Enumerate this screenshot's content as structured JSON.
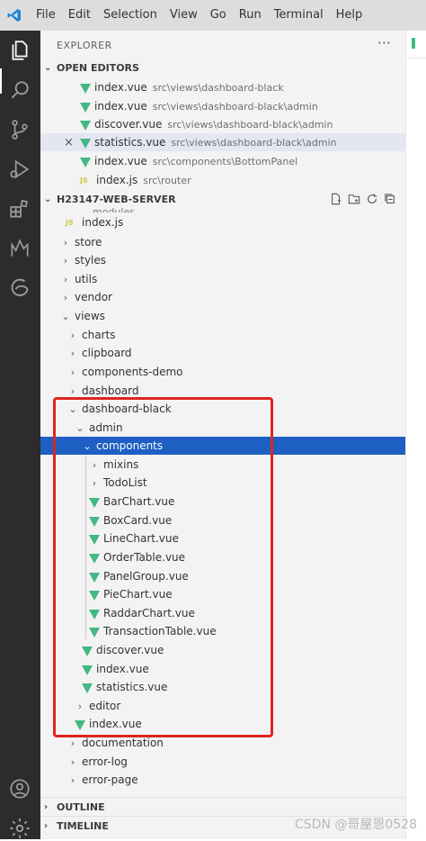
{
  "menu": {
    "items": [
      "File",
      "Edit",
      "Selection",
      "View",
      "Go",
      "Run",
      "Terminal",
      "Help"
    ]
  },
  "explorer": {
    "title": "EXPLORER",
    "more": "···"
  },
  "open_editors": {
    "title": "OPEN EDITORS",
    "items": [
      {
        "name": "index.vue",
        "path": "src\\views\\dashboard-black"
      },
      {
        "name": "index.vue",
        "path": "src\\views\\dashboard-black\\admin"
      },
      {
        "name": "discover.vue",
        "path": "src\\views\\dashboard-black\\admin"
      },
      {
        "name": "statistics.vue",
        "path": "src\\views\\dashboard-black\\admin"
      },
      {
        "name": "index.vue",
        "path": "src\\components\\BottomPanel"
      },
      {
        "name": "index.js",
        "path": "src\\router"
      }
    ]
  },
  "workspace": {
    "title": "H23147-WEB-SERVER",
    "partial_top": "modules"
  },
  "tree": [
    {
      "label": "index.js"
    },
    {
      "label": "store"
    },
    {
      "label": "styles"
    },
    {
      "label": "utils"
    },
    {
      "label": "vendor"
    },
    {
      "label": "views"
    },
    {
      "label": "charts"
    },
    {
      "label": "clipboard"
    },
    {
      "label": "components-demo"
    },
    {
      "label": "dashboard"
    },
    {
      "label": "dashboard-black"
    },
    {
      "label": "admin"
    },
    {
      "label": "components"
    },
    {
      "label": "mixins"
    },
    {
      "label": "TodoList"
    },
    {
      "label": "BarChart.vue"
    },
    {
      "label": "BoxCard.vue"
    },
    {
      "label": "LineChart.vue"
    },
    {
      "label": "OrderTable.vue"
    },
    {
      "label": "PanelGroup.vue"
    },
    {
      "label": "PieChart.vue"
    },
    {
      "label": "RaddarChart.vue"
    },
    {
      "label": "TransactionTable.vue"
    },
    {
      "label": "discover.vue"
    },
    {
      "label": "index.vue"
    },
    {
      "label": "statistics.vue"
    },
    {
      "label": "editor"
    },
    {
      "label": "index.vue"
    },
    {
      "label": "documentation"
    },
    {
      "label": "error-log"
    },
    {
      "label": "error-page"
    }
  ],
  "outline": {
    "title": "OUTLINE"
  },
  "timeline": {
    "title": "TIMELINE"
  },
  "watermark": "CSDN @哥屋恩0528",
  "colors": {
    "selection": "#1d5fc2",
    "highlight_box": "#e0241f",
    "vue_icon": "#42b883",
    "activity_bar": "#2c2c2c"
  }
}
